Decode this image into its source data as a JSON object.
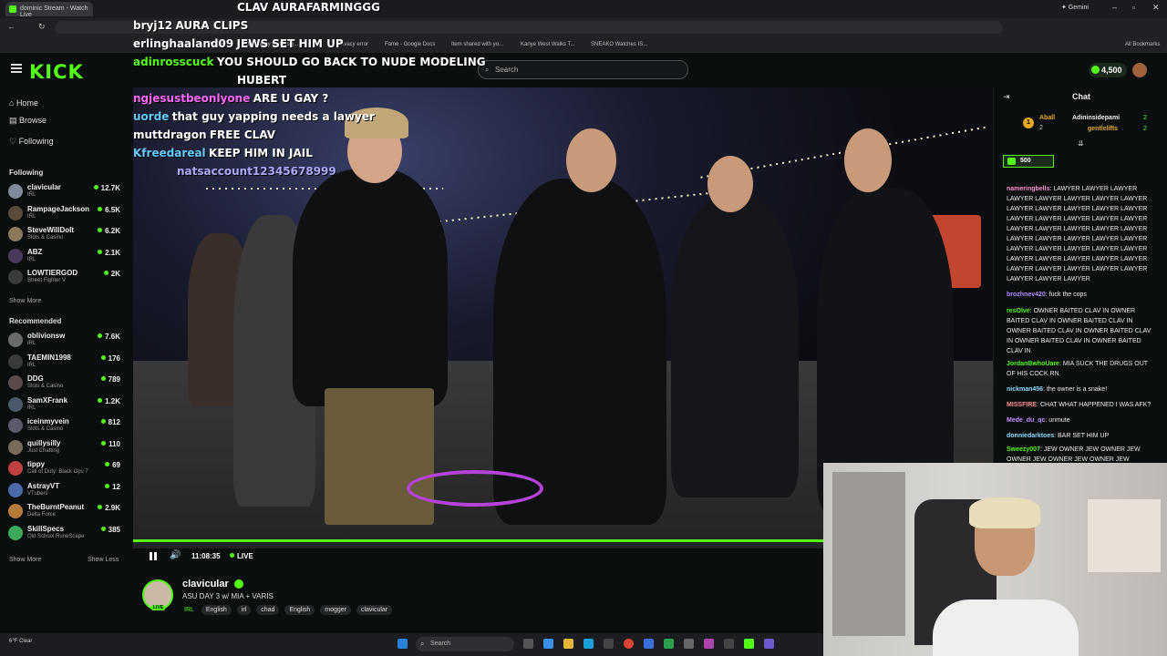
{
  "browser": {
    "tab_title": "dominic Stream - Watch Live",
    "gemini": "✦ Gemini",
    "bookmarks": [
      "Pro 38...",
      "Broadway By Desig...",
      "Privacy error",
      "Fame - Google Docs",
      "Item shared with yo...",
      "Kanye West Walks T...",
      "SNEAKO Watches IS..."
    ],
    "all_bookmarks": "All Bookmarks"
  },
  "header": {
    "logo": "KICK",
    "search_placeholder": "Search",
    "points": "4,500"
  },
  "sidebar": {
    "nav": [
      "Home",
      "Browse",
      "Following"
    ],
    "following_title": "Following",
    "following": [
      {
        "name": "clavicular",
        "cat": "IRL",
        "viewers": "12.7K",
        "color": "#7f8a9a"
      },
      {
        "name": "RampageJackson",
        "cat": "IRL",
        "viewers": "6.5K",
        "color": "#5a4a3a"
      },
      {
        "name": "SteveWillDoIt",
        "cat": "Slots & Casino",
        "viewers": "6.2K",
        "color": "#8a7a5a"
      },
      {
        "name": "ABZ",
        "cat": "IRL",
        "viewers": "2.1K",
        "color": "#4a3a5a"
      },
      {
        "name": "LOWTIERGOD",
        "cat": "Street Fighter V",
        "viewers": "2K",
        "color": "#3a3a3a"
      }
    ],
    "show_more": "Show More",
    "recommended_title": "Recommended",
    "recommended": [
      {
        "name": "oblivionsw",
        "cat": "IRL",
        "viewers": "7.6K",
        "color": "#6a6a6a"
      },
      {
        "name": "TAEMIN1998",
        "cat": "IRL",
        "viewers": "176",
        "color": "#3a3a3a"
      },
      {
        "name": "DDG",
        "cat": "Slots & Casino",
        "viewers": "789",
        "color": "#5a4a4a"
      },
      {
        "name": "SamXFrank",
        "cat": "IRL",
        "viewers": "1.2K",
        "color": "#4a5a6a"
      },
      {
        "name": "iceinmyvein",
        "cat": "Slots & Casino",
        "viewers": "812",
        "color": "#5a5a6a"
      },
      {
        "name": "quillysilly",
        "cat": "Just Chatting",
        "viewers": "110",
        "color": "#7a6a5a"
      },
      {
        "name": "tippy",
        "cat": "Call of Duty: Black Ops 7",
        "viewers": "69",
        "color": "#c04040"
      },
      {
        "name": "AstrayVT",
        "cat": "VTubers",
        "viewers": "12",
        "color": "#4a6aaa"
      },
      {
        "name": "TheBurntPeanut",
        "cat": "Delta Force",
        "viewers": "2.9K",
        "color": "#b87a3a"
      },
      {
        "name": "SkillSpecs",
        "cat": "Old School RuneScape",
        "viewers": "385",
        "color": "#3aaa5a"
      }
    ],
    "show_more2": "Show More",
    "show_less": "Show Less"
  },
  "overlay_chat": [
    {
      "user": "",
      "msg": "CLAV AURAFARMINGGG",
      "color": "#ffffff"
    },
    {
      "user": "bryj12",
      "msg": "AURA CLIPS",
      "color": "#ffffff"
    },
    {
      "user": "erlinghaaland09",
      "msg": "JEWS SET HIM UP",
      "color": "#ffffff"
    },
    {
      "user": "adinrosscuck",
      "msg": "YOU SHOULD GO BACK TO NUDE MODELING",
      "color": "#53fc18"
    },
    {
      "user": "",
      "msg": "HUBERT",
      "color": "#ffffff"
    },
    {
      "user": "ngjesustbeonlyone",
      "msg": "ARE U GAY ?",
      "color": "#ff66ff"
    },
    {
      "user": "uorde",
      "msg": "that guy yapping needs a lawyer",
      "color": "#66ccff"
    },
    {
      "user": "muttdragon",
      "msg": "FREE CLAV",
      "color": "#ffffff"
    },
    {
      "user": "Kfreedareal",
      "msg": "KEEP HIM IN JAIL",
      "color": "#66ccff"
    },
    {
      "user": "natsaccount12345678999",
      "msg": "",
      "color": "#aaaaff"
    }
  ],
  "player": {
    "time": "11:08:35",
    "live": "LIVE",
    "progress": 1.0
  },
  "stream": {
    "name": "clavicular",
    "live_badge": "LIVE",
    "title": "ASU DAY 3 w/ MIA + VARIS",
    "category": "IRL",
    "tags": [
      "English",
      "irl",
      "chad",
      "English",
      "mogger",
      "clavicular"
    ]
  },
  "chat": {
    "title": "Chat",
    "gifter1": "Aball",
    "gifter1_count": "2",
    "gifter2": "Adininsidepami",
    "gifter2_count": "2",
    "gifter3": "gentlelifts",
    "gifter3_count": "2",
    "pinned_amount": "500",
    "messages": [
      {
        "user": "nameringbells",
        "text": "LAWYER LAWYER LAWYER LAWYER LAWYER LAWYER LAWYER LAWYER LAWYER LAWYER LAWYER LAWYER LAWYER LAWYER LAWYER LAWYER LAWYER LAWYER LAWYER LAWYER LAWYER LAWYER LAWYER LAWYER LAWYER LAWYER LAWYER LAWYER LAWYER LAWYER LAWYER LAWYER LAWYER LAWYER LAWYER LAWYER LAWYER LAWYER LAWYER LAWYER LAWYER LAWYER LAWYER LAWYER LAWYER LAWYER",
        "color": "#ff8fd6"
      },
      {
        "user": "brozhnev420",
        "text": "fuck the cops",
        "color": "#b08cff"
      },
      {
        "user": "resOlve",
        "text": "OWNER BAITED CLAV IN OWNER BAITED CLAV IN OWNER BAITED CLAV IN OWNER BAITED CLAV IN OWNER BAITED CLAV IN OWNER BAITED CLAV IN OWNER BAITED CLAV IN",
        "color": "#53fc18"
      },
      {
        "user": "JordanBwhoUare",
        "text": "MIA SUCK THE DRUGS OUT OF HIS COCK RN",
        "color": "#53fc18"
      },
      {
        "user": "nickman456",
        "text": "the owner is a snake!",
        "color": "#8fd8ff"
      },
      {
        "user": "MISSFIRE",
        "text": "CHAT WHAT HAPPENED I WAS AFK?",
        "color": "#ff8f8f"
      },
      {
        "user": "Mede_du_qc",
        "text": "unmute",
        "color": "#c08fff"
      },
      {
        "user": "donniedarktoes",
        "text": "BAR SET HIM UP",
        "color": "#8fd8ff"
      },
      {
        "user": "Sweezy007",
        "text": "JEW OWNER JEW OWNER JEW OWNER JEW OWNER JEW OWNER JEW",
        "color": "#53fc18"
      }
    ]
  },
  "taskbar": {
    "weather": "6°F Clear",
    "search": "Search"
  }
}
